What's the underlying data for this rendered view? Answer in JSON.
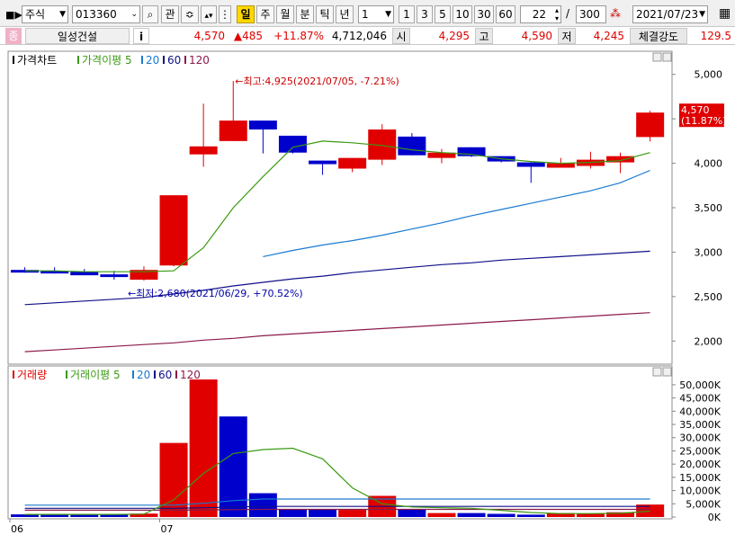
{
  "toolbar": {
    "category": "주식",
    "code": "013360",
    "btn_gwan": "관",
    "periods": [
      "일",
      "주",
      "월",
      "분",
      "틱",
      "년"
    ],
    "period_active": "일",
    "interval_value": "1",
    "quick_counts": [
      "1",
      "3",
      "5",
      "10",
      "30",
      "60"
    ],
    "view_count": "22",
    "slash": "/",
    "total_count": "300",
    "date": "2021/07/23"
  },
  "info": {
    "badge": "종",
    "name": "일성건설",
    "i_btn": "i",
    "price": "4,570",
    "change": "▲485",
    "change_pct": "+11.87%",
    "volume": "4,712,046",
    "open_label": "시",
    "open": "4,295",
    "high_label": "고",
    "high": "4,590",
    "low_label": "저",
    "low": "4,245",
    "strength_label": "체결강도",
    "strength": "129.5"
  },
  "colors": {
    "up": "#e00000",
    "down": "#0000cc",
    "ma5": "#3a9a10",
    "ma20": "#1a7ad0",
    "ma60": "#10108a",
    "ma120": "#8a1a4a",
    "vma5": "#3a9a10"
  },
  "chart_data": [
    {
      "type": "candlestick",
      "legend": [
        "가격차트",
        "가격이평 5",
        "20",
        "60",
        "120"
      ],
      "ylim": [
        1750,
        5250
      ],
      "y_ticks": [
        "5,000",
        "4,500",
        "4,000",
        "3,500",
        "3,000",
        "2,500",
        "2,000"
      ],
      "y_tick_values": [
        5000,
        4500,
        4000,
        3500,
        3000,
        2500,
        2000
      ],
      "x_ticks": [
        "06",
        "07"
      ],
      "candles": [
        {
          "o": 2800,
          "h": 2830,
          "l": 2770,
          "c": 2770
        },
        {
          "o": 2790,
          "h": 2830,
          "l": 2760,
          "c": 2760
        },
        {
          "o": 2780,
          "h": 2810,
          "l": 2740,
          "c": 2740
        },
        {
          "o": 2750,
          "h": 2790,
          "l": 2690,
          "c": 2720
        },
        {
          "o": 2690,
          "h": 2840,
          "l": 2680,
          "c": 2800
        },
        {
          "o": 2850,
          "h": 3640,
          "l": 2840,
          "c": 3640
        },
        {
          "o": 4100,
          "h": 4670,
          "l": 3960,
          "c": 4190
        },
        {
          "o": 4250,
          "h": 4925,
          "l": 4250,
          "c": 4480
        },
        {
          "o": 4480,
          "h": 4480,
          "l": 4110,
          "c": 4380
        },
        {
          "o": 4310,
          "h": 4310,
          "l": 4110,
          "c": 4120
        },
        {
          "o": 4030,
          "h": 4030,
          "l": 3870,
          "c": 3990
        },
        {
          "o": 3940,
          "h": 4060,
          "l": 3900,
          "c": 4060
        },
        {
          "o": 4040,
          "h": 4440,
          "l": 3980,
          "c": 4380
        },
        {
          "o": 4300,
          "h": 4340,
          "l": 4090,
          "c": 4090
        },
        {
          "o": 4060,
          "h": 4160,
          "l": 4000,
          "c": 4120
        },
        {
          "o": 4180,
          "h": 4180,
          "l": 4070,
          "c": 4080
        },
        {
          "o": 4080,
          "h": 4080,
          "l": 4010,
          "c": 4020
        },
        {
          "o": 4010,
          "h": 4010,
          "l": 3780,
          "c": 3960
        },
        {
          "o": 3950,
          "h": 4060,
          "l": 3950,
          "c": 4000
        },
        {
          "o": 3970,
          "h": 4130,
          "l": 3940,
          "c": 4040
        },
        {
          "o": 4010,
          "h": 4120,
          "l": 3890,
          "c": 4080
        },
        {
          "o": 4295,
          "h": 4590,
          "l": 4245,
          "c": 4570
        }
      ],
      "ma5": [
        2790,
        2790,
        2780,
        2780,
        2780,
        2790,
        3050,
        3500,
        3850,
        4180,
        4250,
        4230,
        4200,
        4150,
        4120,
        4100,
        4050,
        4020,
        4000,
        4010,
        4030,
        4120
      ],
      "ma20": [
        null,
        null,
        null,
        null,
        null,
        null,
        null,
        null,
        2950,
        3020,
        3080,
        3130,
        3190,
        3260,
        3330,
        3410,
        3480,
        3550,
        3620,
        3690,
        3780,
        3920
      ],
      "ma60": [
        2410,
        2430,
        2450,
        2470,
        2490,
        2530,
        2570,
        2620,
        2660,
        2700,
        2730,
        2770,
        2800,
        2830,
        2860,
        2880,
        2910,
        2930,
        2950,
        2970,
        2990,
        3010
      ],
      "ma120": [
        1880,
        1900,
        1920,
        1940,
        1960,
        1980,
        2010,
        2030,
        2060,
        2080,
        2100,
        2120,
        2140,
        2160,
        2180,
        2200,
        2220,
        2240,
        2260,
        2280,
        2300,
        2320
      ],
      "annotations": {
        "high": "←최고:4,925(2021/07/05, -7.21%)",
        "low": "←최저:2,680(2021/06/29, +70.52%)"
      },
      "last_price_tag": [
        "4,570",
        "(11.87%)"
      ]
    },
    {
      "type": "bar",
      "legend": [
        "거래량",
        "거래이평 5",
        "20",
        "60",
        "120"
      ],
      "ylim": [
        0,
        52000
      ],
      "y_ticks": [
        "50,000K",
        "45,000K",
        "40,000K",
        "35,000K",
        "30,000K",
        "25,000K",
        "20,000K",
        "15,000K",
        "10,000K",
        "5,000K",
        "0K"
      ],
      "y_tick_values": [
        50000,
        45000,
        40000,
        35000,
        30000,
        25000,
        20000,
        15000,
        10000,
        5000,
        0
      ],
      "volumes": [
        1000,
        1200,
        1000,
        900,
        1300,
        28000,
        52000,
        38000,
        9000,
        3000,
        2800,
        2700,
        8000,
        3000,
        1500,
        1500,
        1200,
        900,
        1500,
        1200,
        1800,
        4712
      ],
      "up": [
        false,
        false,
        false,
        false,
        true,
        true,
        true,
        false,
        false,
        false,
        false,
        true,
        true,
        false,
        true,
        false,
        false,
        false,
        true,
        true,
        true,
        true
      ],
      "vma5": [
        1000,
        1000,
        1000,
        1000,
        1100,
        6500,
        16500,
        24000,
        25500,
        26000,
        22000,
        11000,
        5000,
        3800,
        3500,
        3300,
        2500,
        1700,
        1300,
        1300,
        1400,
        2200
      ],
      "vma20": [
        4500,
        4500,
        4500,
        4500,
        4500,
        4500,
        5200,
        6200,
        6800,
        6800,
        6800,
        6800,
        6800,
        6800,
        6800,
        6800,
        6800,
        6800,
        6800,
        6800,
        6800,
        6800
      ],
      "vma60": [
        3300,
        3300,
        3300,
        3300,
        3300,
        3300,
        3500,
        3800,
        4000,
        4000,
        4000,
        4000,
        4000,
        4000,
        4000,
        4000,
        4000,
        4000,
        4000,
        4000,
        4000,
        4000
      ],
      "vma120": [
        2600,
        2600,
        2600,
        2600,
        2600,
        2600,
        2700,
        2800,
        2900,
        2900,
        2900,
        2900,
        2900,
        2900,
        2900,
        2900,
        2900,
        2900,
        2900,
        2900,
        2900,
        2900
      ]
    }
  ]
}
